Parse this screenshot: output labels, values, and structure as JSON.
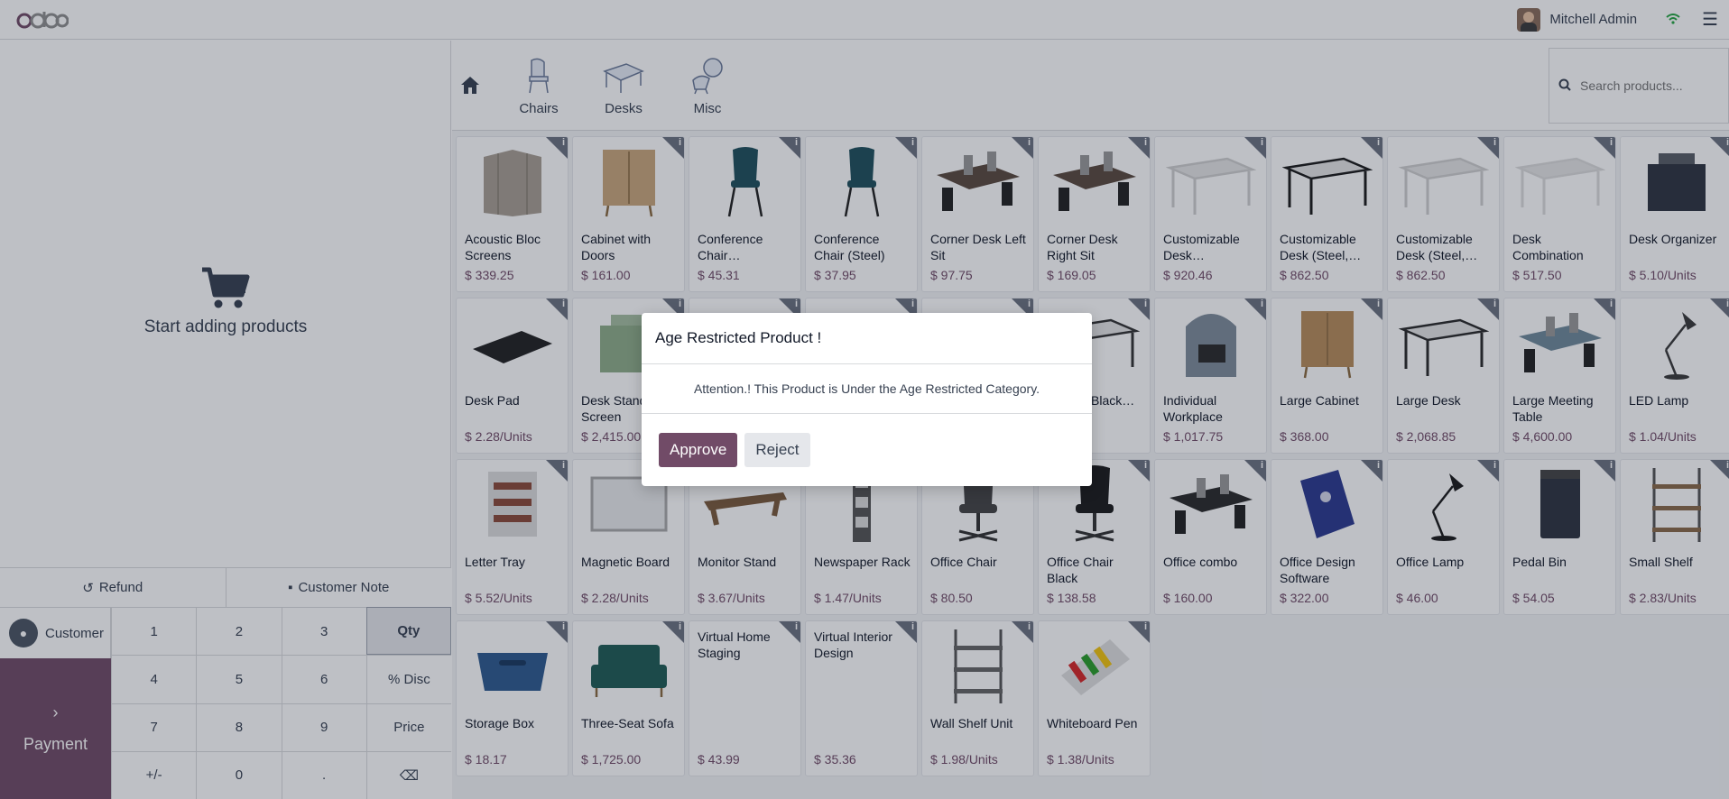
{
  "topbar": {
    "logo": "odoo",
    "user_name": "Mitchell Admin"
  },
  "cart": {
    "empty_text": "Start adding products"
  },
  "actions": {
    "refund": "Refund",
    "customer_note": "Customer Note"
  },
  "pad": {
    "customer": "Customer",
    "payment": "Payment",
    "keys": [
      "1",
      "2",
      "3",
      "Qty",
      "4",
      "5",
      "6",
      "% Disc",
      "7",
      "8",
      "9",
      "Price",
      "+/-",
      "0",
      ".",
      "⌫"
    ]
  },
  "categories": [
    {
      "label": "Chairs",
      "icon": "chair-icon"
    },
    {
      "label": "Desks",
      "icon": "desk-icon"
    },
    {
      "label": "Misc",
      "icon": "misc-icon"
    }
  ],
  "search": {
    "placeholder": "Search products..."
  },
  "products": [
    {
      "name": "Acoustic Bloc Screens",
      "price": "$ 339.25",
      "icon": "screen",
      "color": "#a89f94"
    },
    {
      "name": "Cabinet with Doors",
      "price": "$ 161.00",
      "icon": "cabinet",
      "color": "#c9a77c"
    },
    {
      "name": "Conference Chair…",
      "price": "$ 45.31",
      "icon": "chair",
      "color": "#1f4f5c"
    },
    {
      "name": "Conference Chair (Steel)",
      "price": "$ 37.95",
      "icon": "chair",
      "color": "#1f4f5c"
    },
    {
      "name": "Corner Desk Left Sit",
      "price": "$ 97.75",
      "icon": "deskdark",
      "color": "#5a4a3f"
    },
    {
      "name": "Corner Desk Right Sit",
      "price": "$ 169.05",
      "icon": "deskdark",
      "color": "#5a4a3f"
    },
    {
      "name": "Customizable Desk…",
      "price": "$ 920.46",
      "icon": "desk",
      "color": "#cfcfcf"
    },
    {
      "name": "Customizable Desk (Steel,…",
      "price": "$ 862.50",
      "icon": "desk",
      "color": "#1b1b1b"
    },
    {
      "name": "Customizable Desk (Steel,…",
      "price": "$ 862.50",
      "icon": "desk",
      "color": "#cfcfcf"
    },
    {
      "name": "Desk Combination",
      "price": "$ 517.50",
      "icon": "desk",
      "color": "#dcdcdc"
    },
    {
      "name": "Desk Organizer",
      "price": "$ 5.10/Units",
      "icon": "box",
      "color": "#2e3440"
    },
    {
      "name": "Desk Pad",
      "price": "$ 2.28/Units",
      "icon": "pad",
      "color": "#222222"
    },
    {
      "name": "Desk Stand with Screen",
      "price": "$ 2,415.00",
      "icon": "box",
      "color": "#8fae8a"
    },
    {
      "name": "",
      "price": "",
      "icon": "box",
      "color": "#6b6b6b"
    },
    {
      "name": "",
      "price": "",
      "icon": "box",
      "color": "#c9a77c"
    },
    {
      "name": "",
      "price": "",
      "icon": "box",
      "color": "#444444"
    },
    {
      "name": "Drawer Black…son",
      "price": "$ …50",
      "icon": "desk",
      "color": "#333333"
    },
    {
      "name": "Individual Workplace",
      "price": "$ 1,017.75",
      "icon": "pod",
      "color": "#7e8c9a"
    },
    {
      "name": "Large Cabinet",
      "price": "$ 368.00",
      "icon": "cabinet",
      "color": "#b88c5a"
    },
    {
      "name": "Large Desk",
      "price": "$ 2,068.85",
      "icon": "desk",
      "color": "#2a2a2a"
    },
    {
      "name": "Large Meeting Table",
      "price": "$ 4,600.00",
      "icon": "deskdark",
      "color": "#6f8a9a"
    },
    {
      "name": "LED Lamp",
      "price": "$ 1.04/Units",
      "icon": "lamp",
      "color": "#3a3a3a"
    },
    {
      "name": "Letter Tray",
      "price": "$ 5.52/Units",
      "icon": "tray",
      "color": "#8b4a3a"
    },
    {
      "name": "Magnetic Board",
      "price": "$ 2.28/Units",
      "icon": "board",
      "color": "#e9eaec"
    },
    {
      "name": "Monitor Stand",
      "price": "$ 3.67/Units",
      "icon": "stand",
      "color": "#7a5a3c"
    },
    {
      "name": "Newspaper Rack",
      "price": "$ 1.47/Units",
      "icon": "rack",
      "color": "#555555"
    },
    {
      "name": "Office Chair",
      "price": "$ 80.50",
      "icon": "officechair",
      "color": "#444444"
    },
    {
      "name": "Office Chair Black",
      "price": "$ 138.58",
      "icon": "officechair",
      "color": "#1b1b1b"
    },
    {
      "name": "Office combo",
      "price": "$ 160.00",
      "icon": "deskdark",
      "color": "#2a2a2a"
    },
    {
      "name": "Office Design Software",
      "price": "$ 322.00",
      "icon": "software",
      "color": "#2b3a8f"
    },
    {
      "name": "Office Lamp",
      "price": "$ 46.00",
      "icon": "lamp",
      "color": "#1b1b1b"
    },
    {
      "name": "Pedal Bin",
      "price": "$ 54.05",
      "icon": "bin",
      "color": "#2e3440"
    },
    {
      "name": "Small Shelf",
      "price": "$ 2.83/Units",
      "icon": "shelf",
      "color": "#8a6a4a"
    },
    {
      "name": "Storage Box",
      "price": "$ 18.17",
      "icon": "storage",
      "color": "#2f5a8f"
    },
    {
      "name": "Three-Seat Sofa",
      "price": "$ 1,725.00",
      "icon": "sofa",
      "color": "#1f5c55"
    },
    {
      "name": "Virtual Home Staging",
      "price": "$ 43.99",
      "icon": "none",
      "color": "#ffffff"
    },
    {
      "name": "Virtual Interior Design",
      "price": "$ 35.36",
      "icon": "none",
      "color": "#ffffff"
    },
    {
      "name": "Wall Shelf Unit",
      "price": "$ 1.98/Units",
      "icon": "shelf",
      "color": "#666666"
    },
    {
      "name": "Whiteboard Pen",
      "price": "$ 1.38/Units",
      "icon": "pens",
      "color": "#e0e0e0"
    }
  ],
  "dialog": {
    "title": "Age Restricted Product !",
    "body": "Attention.! This Product is Under the Age Restricted Category.",
    "approve": "Approve",
    "reject": "Reject"
  },
  "colors": {
    "brand": "#714b67",
    "overlay": "rgba(20,28,48,0.28)"
  }
}
